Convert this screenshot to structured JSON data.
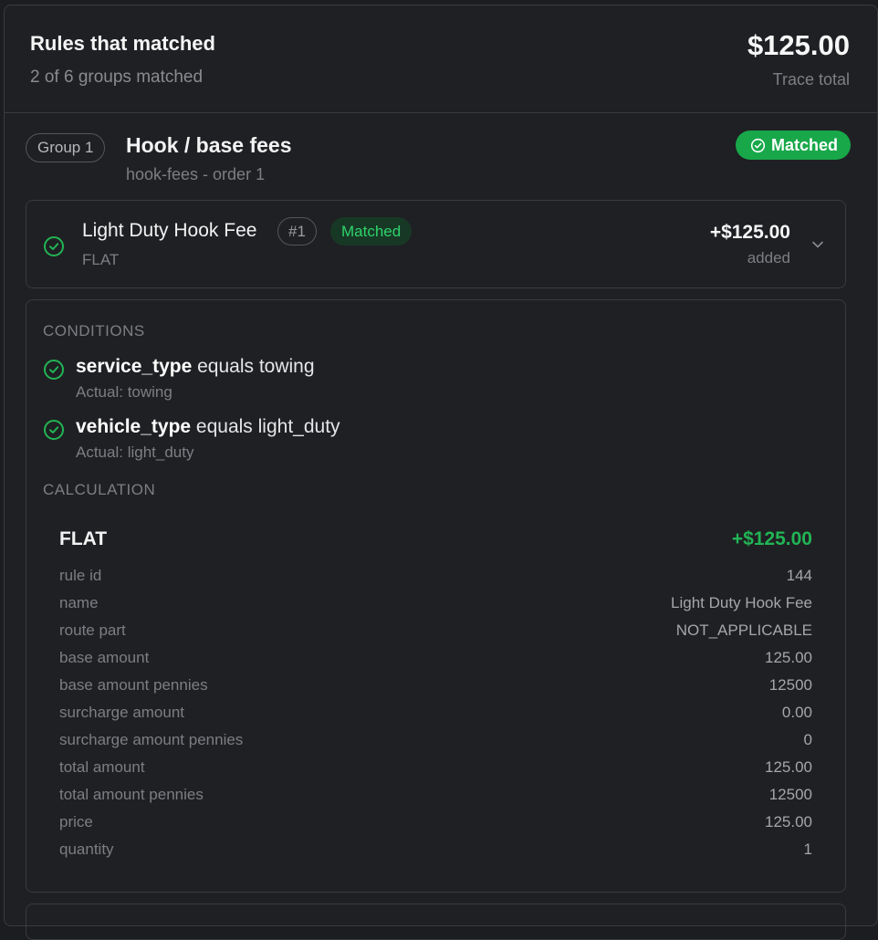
{
  "header": {
    "title": "Rules that matched",
    "subtitle": "2 of 6 groups matched",
    "total": "$125.00",
    "total_label": "Trace total"
  },
  "group": {
    "pill": "Group 1",
    "title": "Hook / base fees",
    "subtitle": "hook-fees - order 1",
    "status": "Matched"
  },
  "rule": {
    "name": "Light Duty Hook Fee",
    "number": "#1",
    "status": "Matched",
    "type": "FLAT",
    "amount": "+$125.00",
    "amount_label": "added"
  },
  "conditions": {
    "label": "CONDITIONS",
    "items": [
      {
        "field": "service_type",
        "text": " equals towing",
        "actual": "Actual: towing"
      },
      {
        "field": "vehicle_type",
        "text": " equals light_duty",
        "actual": "Actual: light_duty"
      }
    ]
  },
  "calculation": {
    "label": "CALCULATION",
    "title": "FLAT",
    "amount": "+$125.00",
    "rows": [
      {
        "key": "rule id",
        "value": "144"
      },
      {
        "key": "name",
        "value": "Light Duty Hook Fee"
      },
      {
        "key": "route part",
        "value": "NOT_APPLICABLE"
      },
      {
        "key": "base amount",
        "value": "125.00"
      },
      {
        "key": "base amount pennies",
        "value": "12500"
      },
      {
        "key": "surcharge amount",
        "value": "0.00"
      },
      {
        "key": "surcharge amount pennies",
        "value": "0"
      },
      {
        "key": "total amount",
        "value": "125.00"
      },
      {
        "key": "total amount pennies",
        "value": "12500"
      },
      {
        "key": "price",
        "value": "125.00"
      },
      {
        "key": "quantity",
        "value": "1"
      }
    ]
  },
  "icons": {
    "check": "check-circle-icon",
    "chevron": "chevron-down-icon"
  },
  "colors": {
    "matched_green": "#18a84a",
    "accent_green": "#22b455",
    "background": "#1f2023"
  }
}
